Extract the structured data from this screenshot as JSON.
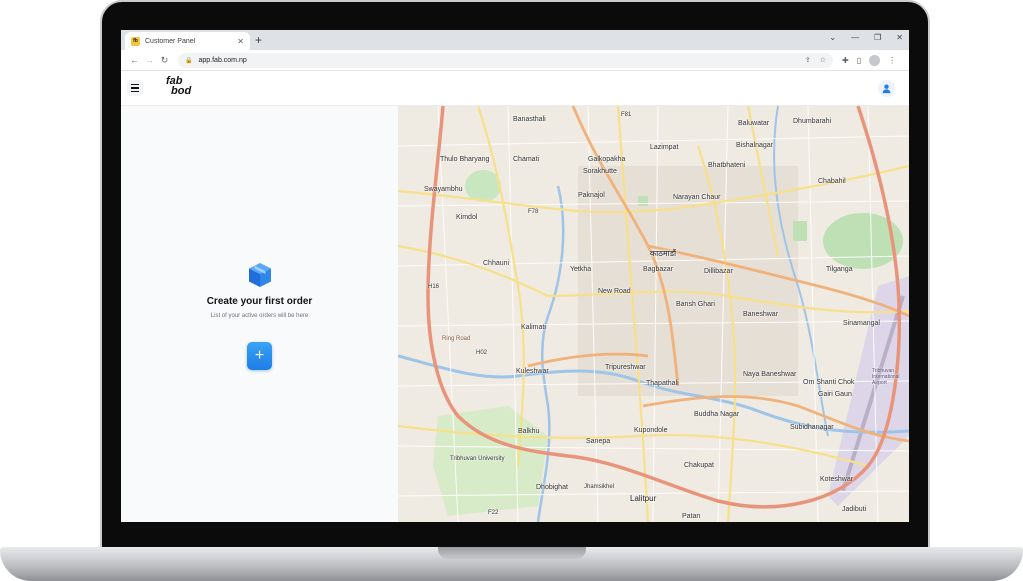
{
  "browser": {
    "tab_title": "Customer Panel",
    "tab_favicon_text": "fb",
    "url": "app.fab.com.np"
  },
  "app": {
    "logo_line1": "fab",
    "logo_line2": "bod"
  },
  "empty_state": {
    "title": "Create your first order",
    "subtitle": "List of your active orders will be here"
  },
  "map_labels": [
    "Banasthali",
    "Lazimpat",
    "Baluwatar",
    "Dhumbarahi",
    "Bishalnagar",
    "Thulo Bharyang",
    "Chamati",
    "Galkopakha",
    "Sorakhutte",
    "Bhatbhateni",
    "Chabahil",
    "Swayambhu",
    "Paknajol",
    "Kimdol",
    "Narayan Chaur",
    "काठमाडौं",
    "Chhauni",
    "Yetkha",
    "Bagbazar",
    "Dillibazar",
    "Tilganga",
    "New Road",
    "Bansh Ghari",
    "Baneshwar",
    "Sinamangal",
    "Kalimati",
    "Kuleshwar",
    "Tripureshwar",
    "Thapathali",
    "Naya Baneshwar",
    "Om Shanti Chok",
    "Gairi Gaun",
    "Buddha Nagar",
    "Balkhu",
    "Kupondole",
    "Subidhanagar",
    "Sanepa",
    "Tribhuvan University",
    "Chakupat",
    "Dhobighat",
    "Jhamsikhel",
    "Koteshwar",
    "Lalitpur",
    "Patan",
    "Jadibuti",
    "Ring Road",
    "F81",
    "F78",
    "H16",
    "H02",
    "F22",
    "Tribhuvan International Airport"
  ],
  "colors": {
    "accent_blue": "#1e7de6",
    "map_bg": "#f1ede6",
    "road_yellow": "#f7e08a",
    "road_orange": "#f0b27a",
    "ring_road": "#e8947a",
    "river": "#9ec4e8",
    "park": "#c8e6c0"
  },
  "icons": {
    "hamburger": "menu-icon",
    "avatar": "user-avatar-icon",
    "box": "package-box-icon",
    "add": "plus-icon"
  }
}
